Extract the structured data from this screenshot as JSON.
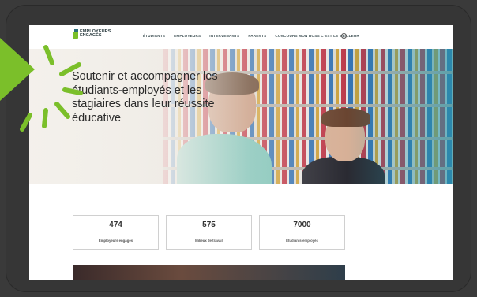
{
  "logo": {
    "line1": "EMPLOYEURS",
    "line2": "ENGAGÉS",
    "line3": ""
  },
  "nav": {
    "items": [
      "ÉTUDIANTS",
      "EMPLOYEURS",
      "INTERVENANTS",
      "PARENTS",
      "CONCOURS MON BOSS C'EST LE MEILLEUR"
    ]
  },
  "hero": {
    "headline": "Soutenir et accompagner les étudiants-employés et les stagiaires dans leur réussite éducative"
  },
  "stats": [
    {
      "value": "474",
      "label": "Employeurs engagés"
    },
    {
      "value": "575",
      "label": "Milieux de travail"
    },
    {
      "value": "7000",
      "label": "Étudiants-employés"
    }
  ],
  "colors": {
    "accent_green": "#7bbf2a",
    "frame": "#363636",
    "teal": "#2f8fa3"
  },
  "icons": {
    "search": "search-icon"
  }
}
